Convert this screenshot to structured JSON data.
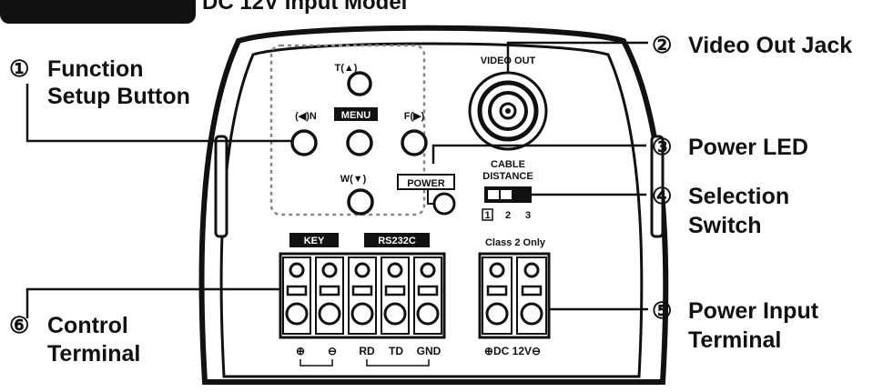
{
  "header": {
    "badge": "",
    "title": "DC 12V Input Model"
  },
  "callouts": [
    {
      "num": "①",
      "line1": "Function",
      "line2": "Setup Button"
    },
    {
      "num": "②",
      "line1": "Video Out Jack",
      "line2": ""
    },
    {
      "num": "③",
      "line1": "Power LED",
      "line2": ""
    },
    {
      "num": "④",
      "line1": "Selection",
      "line2": "Switch"
    },
    {
      "num": "⑤",
      "line1": "Power Input",
      "line2": "Terminal"
    },
    {
      "num": "⑥",
      "line1": "Control",
      "line2": "Terminal"
    }
  ],
  "panel": {
    "btn_up": "T(▲)",
    "btn_left": "(◀)N",
    "btn_menu": "MENU",
    "btn_right": "F(▶)",
    "btn_down": "W(▼)",
    "power": "POWER",
    "video_out": "VIDEO OUT",
    "cable_line1": "CABLE",
    "cable_line2": "DISTANCE",
    "switch_positions": [
      "1",
      "2",
      "3"
    ],
    "key_label": "KEY",
    "rs232_label": "RS232C",
    "class_label": "Class 2 Only",
    "control_pins": [
      "⊕",
      "⊖",
      "RD",
      "TD",
      "GND"
    ],
    "power_pins": "⊕DC 12V⊖"
  },
  "colors": {
    "ink": "#111111",
    "paper": "#ffffff",
    "guide": "#888888"
  }
}
